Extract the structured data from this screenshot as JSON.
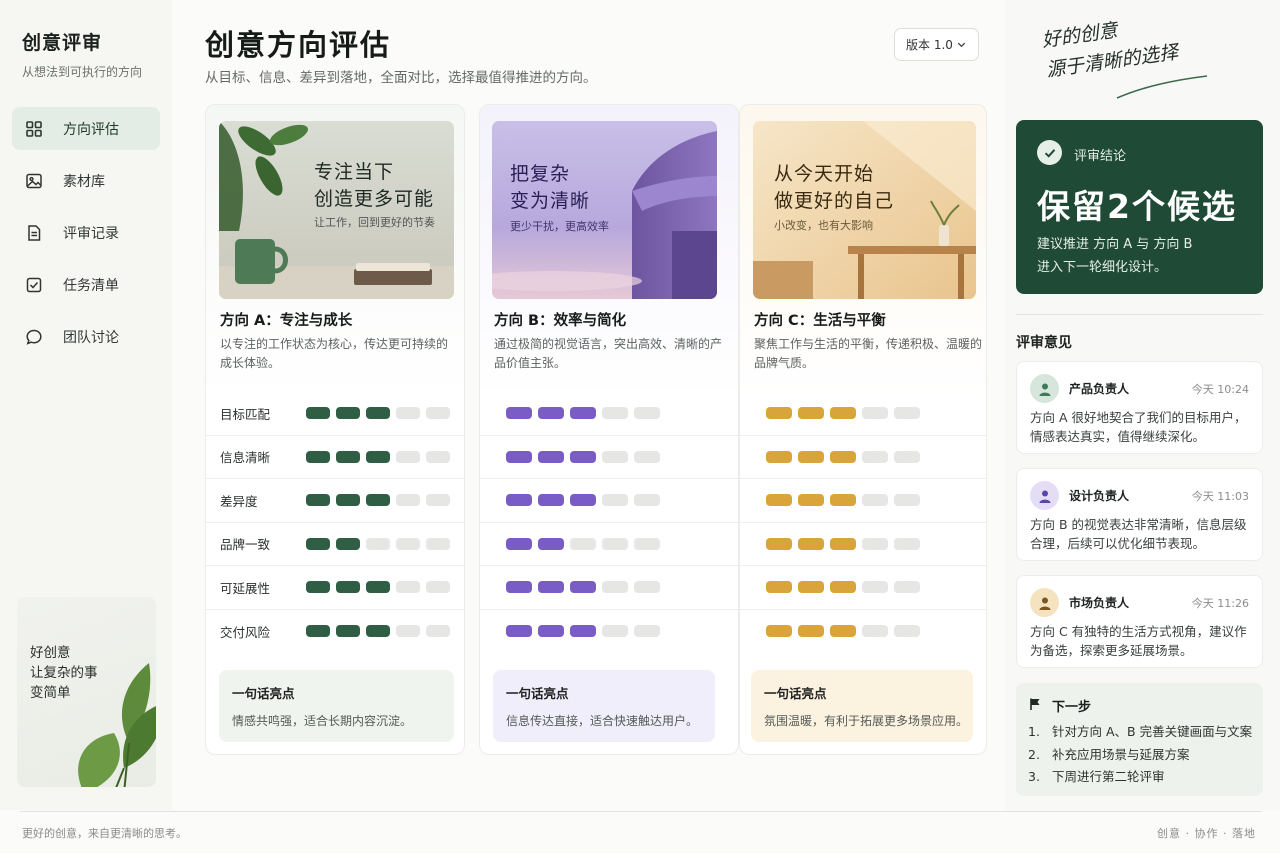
{
  "brand": {
    "title": "创意评审",
    "subtitle": "从想法到可执行的方向"
  },
  "nav": [
    {
      "label": "方向评估",
      "icon": "grid-icon",
      "active": true
    },
    {
      "label": "素材库",
      "icon": "image-icon"
    },
    {
      "label": "评审记录",
      "icon": "document-icon"
    },
    {
      "label": "任务清单",
      "icon": "checkbox-icon"
    },
    {
      "label": "团队讨论",
      "icon": "chat-bubble-icon"
    }
  ],
  "side_card": {
    "text": "好创意\n让复杂的事\n变简单"
  },
  "header": {
    "title": "创意方向评估",
    "subtitle": "从目标、信息、差异到落地，全面对比，选择最值得推进的方向。",
    "version": "版本 1.0"
  },
  "metrics_labels": [
    "目标匹配",
    "信息清晰",
    "差异度",
    "品牌一致",
    "可延展性",
    "交付风险"
  ],
  "cards": [
    {
      "hero_title": "专注当下\n创造更多可能",
      "hero_sub": "让工作，回到更好的节奏",
      "name": "方向 A：专注与成长",
      "desc": "以专注的工作状态为核心，传达更可持续的成长体验。",
      "scores": [
        3,
        3,
        3,
        2,
        3,
        3
      ],
      "highlight_title": "一句话亮点",
      "highlight_text": "情感共鸣强，适合长期内容沉淀。"
    },
    {
      "hero_title": "把复杂\n变为清晰",
      "hero_sub": "更少干扰，更高效率",
      "name": "方向 B：效率与简化",
      "desc": "通过极简的视觉语言，突出高效、清晰的产品价值主张。",
      "scores": [
        3,
        3,
        3,
        2,
        3,
        3
      ],
      "highlight_title": "一句话亮点",
      "highlight_text": "信息传达直接，适合快速触达用户。"
    },
    {
      "hero_title": "从今天开始\n做更好的自己",
      "hero_sub": "小改变，也有大影响",
      "name": "方向 C：生活与平衡",
      "desc": "聚焦工作与生活的平衡，传递积极、温暖的品牌气质。",
      "scores": [
        3,
        3,
        3,
        3,
        3,
        3
      ],
      "highlight_title": "一句话亮点",
      "highlight_text": "氛围温暖，有利于拓展更多场景应用。"
    }
  ],
  "slogan": "好的创意\n源于清晰的选择",
  "verdict": {
    "label": "评审结论",
    "main": "保留2个候选",
    "text_line1": "建议推进 方向 A 与 方向 B",
    "text_line2": "进入下一轮细化设计。"
  },
  "opinions_title": "评审意见",
  "comments": [
    {
      "role": "产品负责人",
      "time": "今天 10:24",
      "text": "方向 A 很好地契合了我们的目标用户，情感表达真实，值得继续深化。",
      "avatar_color": "#d6e6dc",
      "avatar_fg": "#3f7a5a"
    },
    {
      "role": "设计负责人",
      "time": "今天 11:03",
      "text": "方向 B 的视觉表达非常清晰，信息层级合理，后续可以优化细节表现。",
      "avatar_color": "#e3ddf6",
      "avatar_fg": "#5a45a8"
    },
    {
      "role": "市场负责人",
      "time": "今天 11:26",
      "text": "方向 C 有独特的生活方式视角，建议作为备选，探索更多延展场景。",
      "avatar_color": "#f5e2bf",
      "avatar_fg": "#7a5520"
    }
  ],
  "next_steps": {
    "title": "下一步",
    "items": [
      {
        "num": "1.",
        "text": "针对方向 A、B 完善关键画面与文案"
      },
      {
        "num": "2.",
        "text": "补充应用场景与延展方案"
      },
      {
        "num": "3.",
        "text": "下周进行第二轮评审"
      }
    ]
  },
  "footer": {
    "left": "更好的创意，来自更清晰的思考。",
    "right": "创意 · 协作 · 落地"
  },
  "colors": {
    "accent_green": "#1f4a35",
    "dot_a": "#2f5e45",
    "dot_b": "#7a5cc6",
    "dot_c": "#d9a53a"
  }
}
